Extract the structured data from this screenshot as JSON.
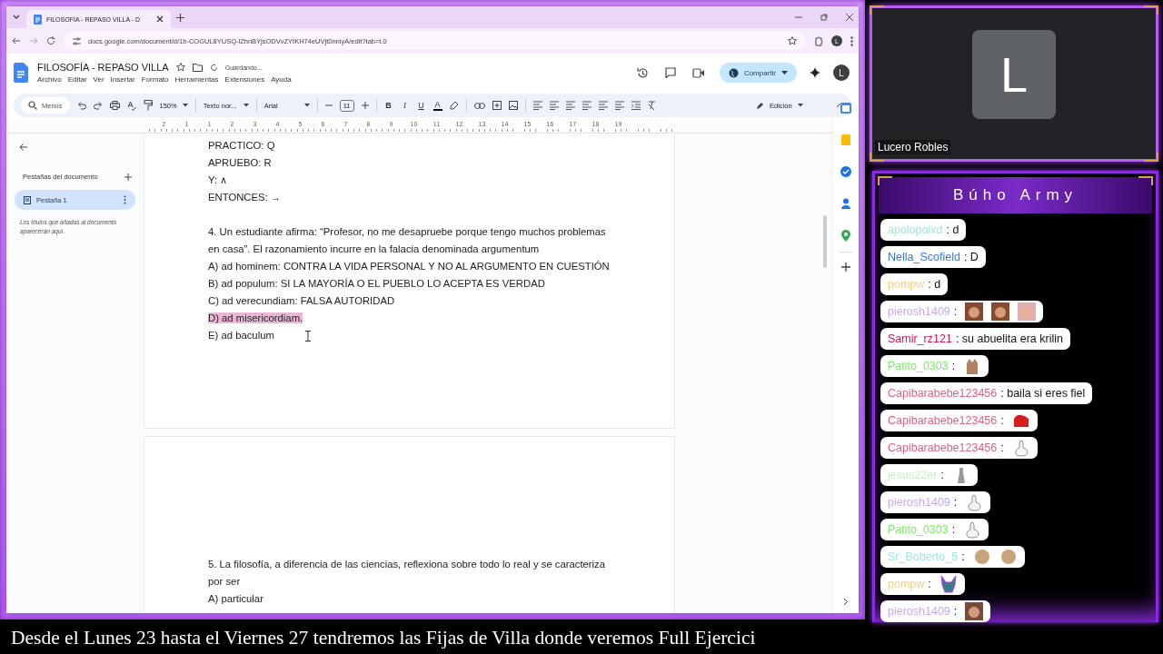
{
  "browser": {
    "tabs": [
      {
        "title": "FILOSOFÍA - REPASO VILLA - D",
        "selected": true
      }
    ],
    "url": "docs.google.com/document/d/1b-COGUL8YUSQ-lZhnBYjsODVvZYtKH74eUVjt0nniyA/edit?tab=t.0",
    "profile": "L"
  },
  "docs": {
    "title": "FILOSOFÍA - REPASO VILLA",
    "save_status": "Guardando...",
    "menus": [
      "Archivo",
      "Editar",
      "Ver",
      "Insertar",
      "Formato",
      "Herramientas",
      "Extensiones",
      "Ayuda"
    ],
    "share_label": "Compartir",
    "avatar": "L",
    "toolbar": {
      "search": "Menús",
      "zoom": "150%",
      "style": "Texto nor...",
      "font": "Arial",
      "size": "11",
      "format": [
        "B",
        "I",
        "U",
        "A"
      ],
      "mode": "Edición"
    },
    "ruler": [
      "2",
      "1",
      "1",
      "2",
      "3",
      "4",
      "5",
      "6",
      "7",
      "8",
      "9",
      "10",
      "11",
      "12",
      "13",
      "14",
      "15",
      "16",
      "17",
      "18",
      "19"
    ],
    "sidebar": {
      "heading": "Pestañas del documento",
      "tabs": [
        {
          "label": "Pestaña 1",
          "selected": true
        }
      ],
      "hint": "Los títulos que añadas al documento aparecerán aquí."
    },
    "pages": [
      {
        "lines": [
          {
            "text": "PRACTICO: Q",
            "highlighted": false
          },
          {
            "text": "APRUEBO: R",
            "highlighted": false
          },
          {
            "text": "Y: ∧",
            "highlighted": false
          },
          {
            "text": "ENTONCES: →",
            "highlighted": false
          },
          {
            "kind": "question",
            "text": "4. Un estudiante afirma: “Profesor, no me desapruebe porque tengo muchos problemas en casa”. El razonamiento incurre en la falacia denominada argumentum",
            "highlighted": false
          },
          {
            "text": "A) ad hominem: CONTRA LA VIDA PERSONAL Y NO AL ARGUMENTO EN CUESTIÓN",
            "highlighted": false
          },
          {
            "text": "B) ad populum: SI LA MAYORÍA O EL PUEBLO LO ACEPTA ES VERDAD",
            "highlighted": false
          },
          {
            "text": "C) ad verecundiam: FALSA AUTORIDAD",
            "highlighted": false
          },
          {
            "text": "D) ad misericordiam.",
            "highlighted": true
          },
          {
            "text": "E) ad baculum",
            "highlighted": false
          }
        ]
      },
      {
        "lines": [
          {
            "text": "5. La filosofía, a diferencia de las ciencias, reflexiona sobre todo lo real y se caracteriza por ser",
            "highlighted": false
          },
          {
            "text": "A) particular",
            "highlighted": false
          }
        ]
      }
    ]
  },
  "webcam": {
    "initial": "L",
    "name": "Lucero Robles"
  },
  "chat": {
    "title": "Búho Army",
    "messages": [
      {
        "user": "apolopoixd",
        "color": "#a6e3d6",
        "text": ": d"
      },
      {
        "user": "Nella_Scofield",
        "color": "#3b78d0",
        "text": ": D"
      },
      {
        "user": "pompw",
        "color": "#f3cf8e",
        "text": ": d"
      },
      {
        "user": "pierosh1409",
        "color": "#c5a8ef",
        "text": ":",
        "emotes": [
          {
            "kind": "face"
          },
          {
            "kind": "face"
          },
          {
            "kind": "pale"
          }
        ]
      },
      {
        "user": "Samir_rz121",
        "color": "#c2185b",
        "text": ": su abuelita era krilin"
      },
      {
        "user": "Patito_0303",
        "color": "#7ee86c",
        "text": ":",
        "emotes": [
          {
            "kind": "cat"
          }
        ]
      },
      {
        "user": "Capibarabebe123456",
        "color": "#de6283",
        "text": ": baila si eres fiel"
      },
      {
        "user": "Capibarabebe123456",
        "color": "#de6283",
        "text": ":",
        "emotes": [
          {
            "kind": "blob"
          }
        ]
      },
      {
        "user": "Capibarabebe123456",
        "color": "#de6283",
        "text": ":",
        "emotes": [
          {
            "kind": "goose"
          }
        ]
      },
      {
        "user": "jesus22er",
        "color": "#c6efbf",
        "text": ":",
        "emotes": [
          {
            "kind": "figure"
          }
        ]
      },
      {
        "user": "pierosh1409",
        "color": "#c5a8ef",
        "text": ":",
        "emotes": [
          {
            "kind": "goose"
          }
        ]
      },
      {
        "user": "Patito_0303",
        "color": "#7ee86c",
        "text": ":",
        "emotes": [
          {
            "kind": "goose"
          }
        ]
      },
      {
        "user": "Sr_Boberto_5",
        "color": "#a3e6df",
        "text": ":",
        "emotes": [
          {
            "kind": "pug"
          },
          {
            "kind": "pug"
          }
        ]
      },
      {
        "user": "pompw",
        "color": "#f3cf8e",
        "text": ":",
        "emotes": [
          {
            "kind": "creature"
          }
        ]
      },
      {
        "user": "pierosh1409",
        "color": "#c5a8ef",
        "text": ":",
        "emotes": [
          {
            "kind": "photo"
          }
        ]
      }
    ]
  },
  "banner": "Desde el Lunes 23 hasta el Viernes 27 tendremos las Fijas de Villa donde veremos Full Ejercici"
}
